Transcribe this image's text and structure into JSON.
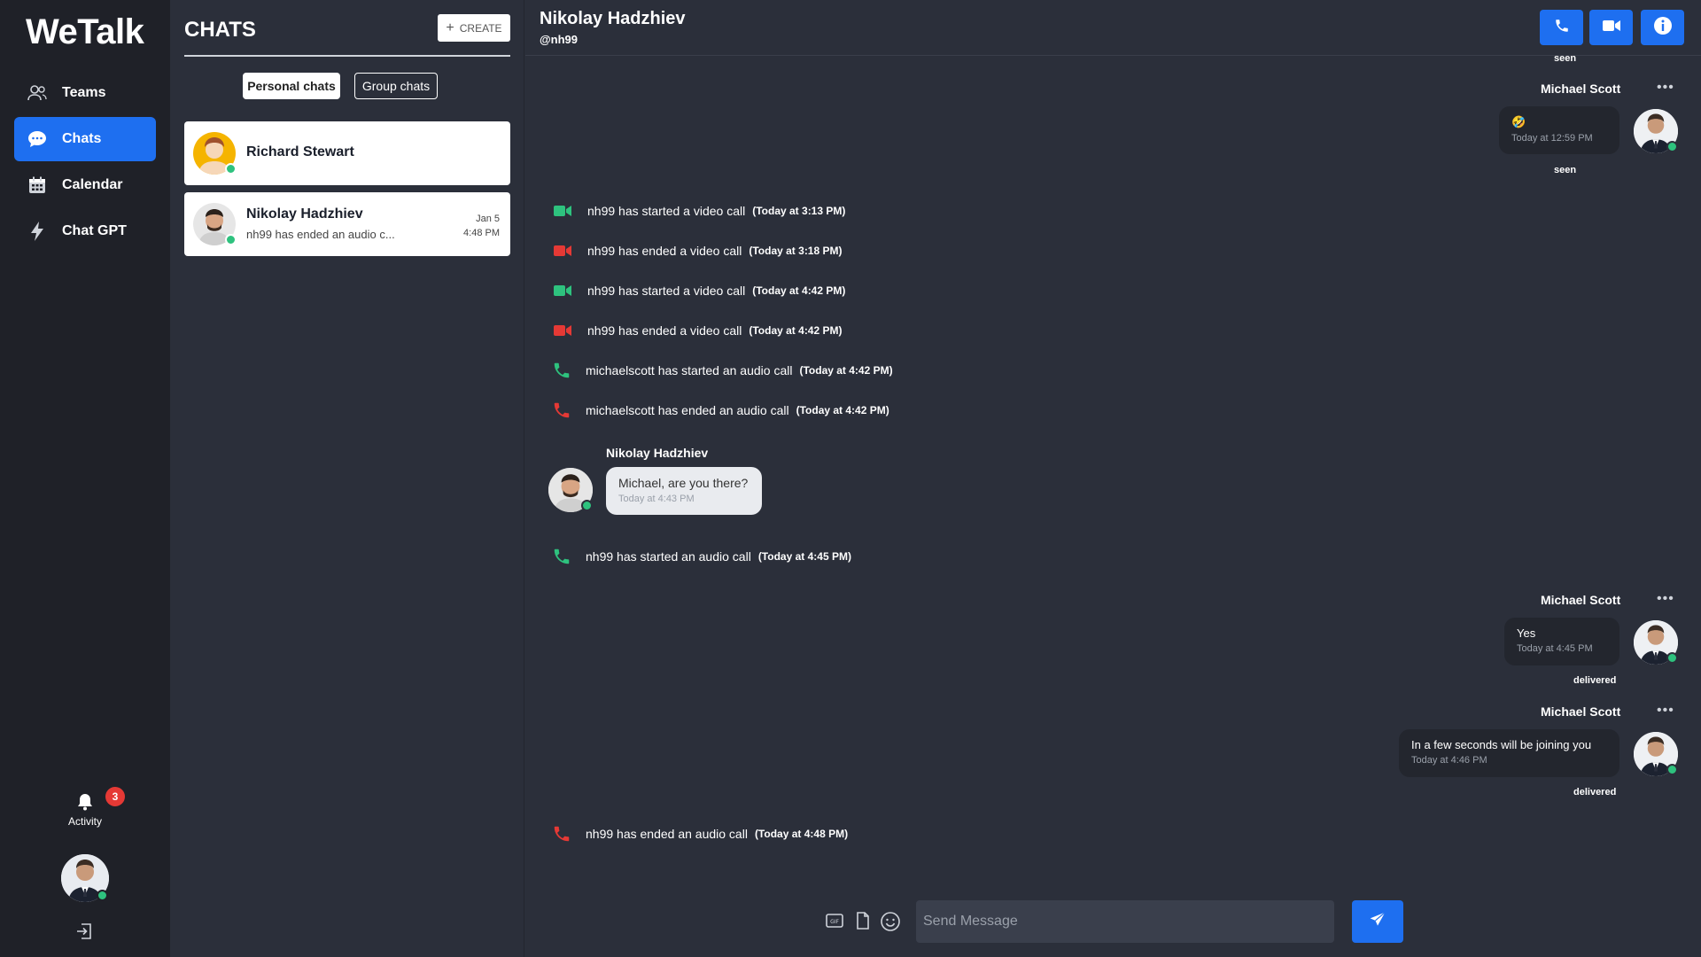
{
  "app": {
    "name": "WeTalk"
  },
  "nav": {
    "items": [
      {
        "label": "Teams",
        "icon": "people-icon",
        "active": false
      },
      {
        "label": "Chats",
        "icon": "chat-icon",
        "active": true
      },
      {
        "label": "Calendar",
        "icon": "calendar-icon",
        "active": false
      },
      {
        "label": "Chat GPT",
        "icon": "bolt-icon",
        "active": false
      }
    ],
    "activity": {
      "label": "Activity",
      "count": "3"
    }
  },
  "chats_panel": {
    "title": "CHATS",
    "create_label": "CREATE",
    "tabs": {
      "personal": "Personal chats",
      "group": "Group chats"
    },
    "chats": [
      {
        "name": "Richard Stewart",
        "preview": "",
        "date": "",
        "time": ""
      },
      {
        "name": "Nikolay Hadzhiev",
        "preview": "nh99 has ended an audio c...",
        "date": "Jan 5",
        "time": "4:48 PM"
      }
    ]
  },
  "conversation": {
    "name": "Nikolay Hadzhiev",
    "handle": "@nh99",
    "top_status": "seen",
    "messages": [
      {
        "sender": "Michael Scott",
        "text": "🤣",
        "time": "Today at 12:59 PM",
        "status": "seen"
      },
      {
        "sender": "Michael Scott",
        "text": "Yes",
        "time": "Today at 4:45 PM",
        "status": "delivered"
      },
      {
        "sender": "Michael Scott",
        "text": "In a few seconds will be joining you",
        "time": "Today at 4:46 PM",
        "status": "delivered"
      }
    ],
    "incoming": {
      "sender": "Nikolay Hadzhiev",
      "text": "Michael, are you there?",
      "time": "Today at 4:43 PM"
    },
    "events": [
      {
        "text": "nh99 has started a video call",
        "time": "(Today at 3:13 PM)",
        "kind": "video-start",
        "color": "#2ec27e"
      },
      {
        "text": "nh99 has ended a video call",
        "time": "(Today at 3:18 PM)",
        "kind": "video-end",
        "color": "#e53935"
      },
      {
        "text": "nh99 has started a video call",
        "time": "(Today at 4:42 PM)",
        "kind": "video-start",
        "color": "#2ec27e"
      },
      {
        "text": "nh99 has ended a video call",
        "time": "(Today at 4:42 PM)",
        "kind": "video-end",
        "color": "#e53935"
      },
      {
        "text": "michaelscott has started an audio call",
        "time": "(Today at 4:42 PM)",
        "kind": "audio-start",
        "color": "#2ec27e"
      },
      {
        "text": "michaelscott has ended an audio call",
        "time": "(Today at 4:42 PM)",
        "kind": "audio-end",
        "color": "#e53935"
      },
      {
        "text": "nh99 has started an audio call",
        "time": "(Today at 4:45 PM)",
        "kind": "audio-start",
        "color": "#2ec27e"
      },
      {
        "text": "nh99 has ended an audio call",
        "time": "(Today at 4:48 PM)",
        "kind": "audio-end",
        "color": "#e53935"
      }
    ],
    "composer": {
      "placeholder": "Send Message"
    }
  },
  "colors": {
    "accent": "#1e6ff0",
    "online": "#2ec27e",
    "danger": "#e53935"
  }
}
